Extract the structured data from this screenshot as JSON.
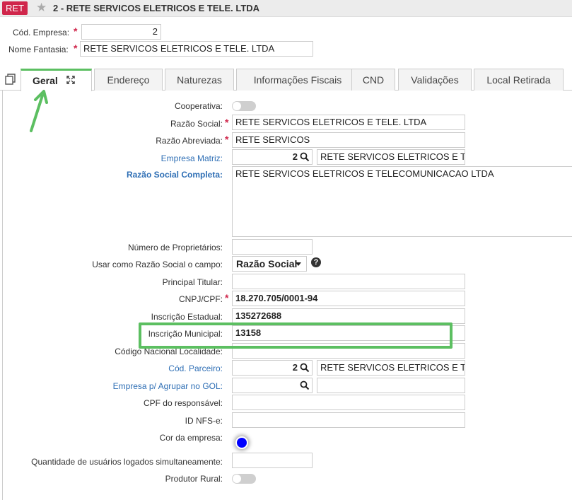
{
  "titlebar": {
    "badge": "RET",
    "title": "2 - RETE SERVICOS ELETRICOS E TELE. LTDA"
  },
  "header": {
    "cod_empresa_label": "Cód. Empresa:",
    "cod_empresa_value": "2",
    "nome_fantasia_label": "Nome Fantasia:",
    "nome_fantasia_value": "RETE SERVICOS ELETRICOS E TELE. LTDA"
  },
  "tabs": [
    "Geral",
    "Endereço",
    "Naturezas",
    "Informações Fiscais",
    "CND",
    "Validações",
    "Local Retirada"
  ],
  "form": {
    "cooperativa_label": "Cooperativa:",
    "razao_social_label": "Razão Social:",
    "razao_social_value": "RETE SERVICOS ELETRICOS E TELE. LTDA",
    "razao_abreviada_label": "Razão Abreviada:",
    "razao_abreviada_value": "RETE SERVICOS",
    "empresa_matriz_label": "Empresa Matriz:",
    "empresa_matriz_code": "2",
    "empresa_matriz_name": "RETE SERVICOS ELETRICOS E T",
    "razao_completa_label": "Razão Social Completa:",
    "razao_completa_value": "RETE SERVICOS ELETRICOS E TELECOMUNICACAO LTDA",
    "num_proprietarios_label": "Número de Proprietários:",
    "usar_como_label": "Usar como Razão Social o campo:",
    "usar_como_value": "Razão Social",
    "principal_titular_label": "Principal Titular:",
    "cnpj_label": "CNPJ/CPF:",
    "cnpj_value": "18.270.705/0001-94",
    "insc_estadual_label": "Inscrição Estadual:",
    "insc_estadual_value": "135272688",
    "insc_municipal_label": "Inscrição Municipal:",
    "insc_municipal_value": "13158",
    "cod_nacional_label": "Código Nacional Localidade:",
    "cod_parceiro_label": "Cód. Parceiro:",
    "cod_parceiro_code": "2",
    "cod_parceiro_name": "RETE SERVICOS ELETRICOS E T",
    "empresa_agrupar_label": "Empresa p/ Agrupar no GOL:",
    "cpf_responsavel_label": "CPF do responsável:",
    "id_nfse_label": "ID NFS-e:",
    "cor_empresa_label": "Cor da empresa:",
    "cor_empresa_value": "#0000ff",
    "qtd_usuarios_label": "Quantidade de usuários logados simultaneamente:",
    "produtor_rural_label": "Produtor Rural:"
  },
  "colors": {
    "accent": "#5cbf61",
    "required": "#d0264b",
    "link": "#2f6fb5"
  }
}
